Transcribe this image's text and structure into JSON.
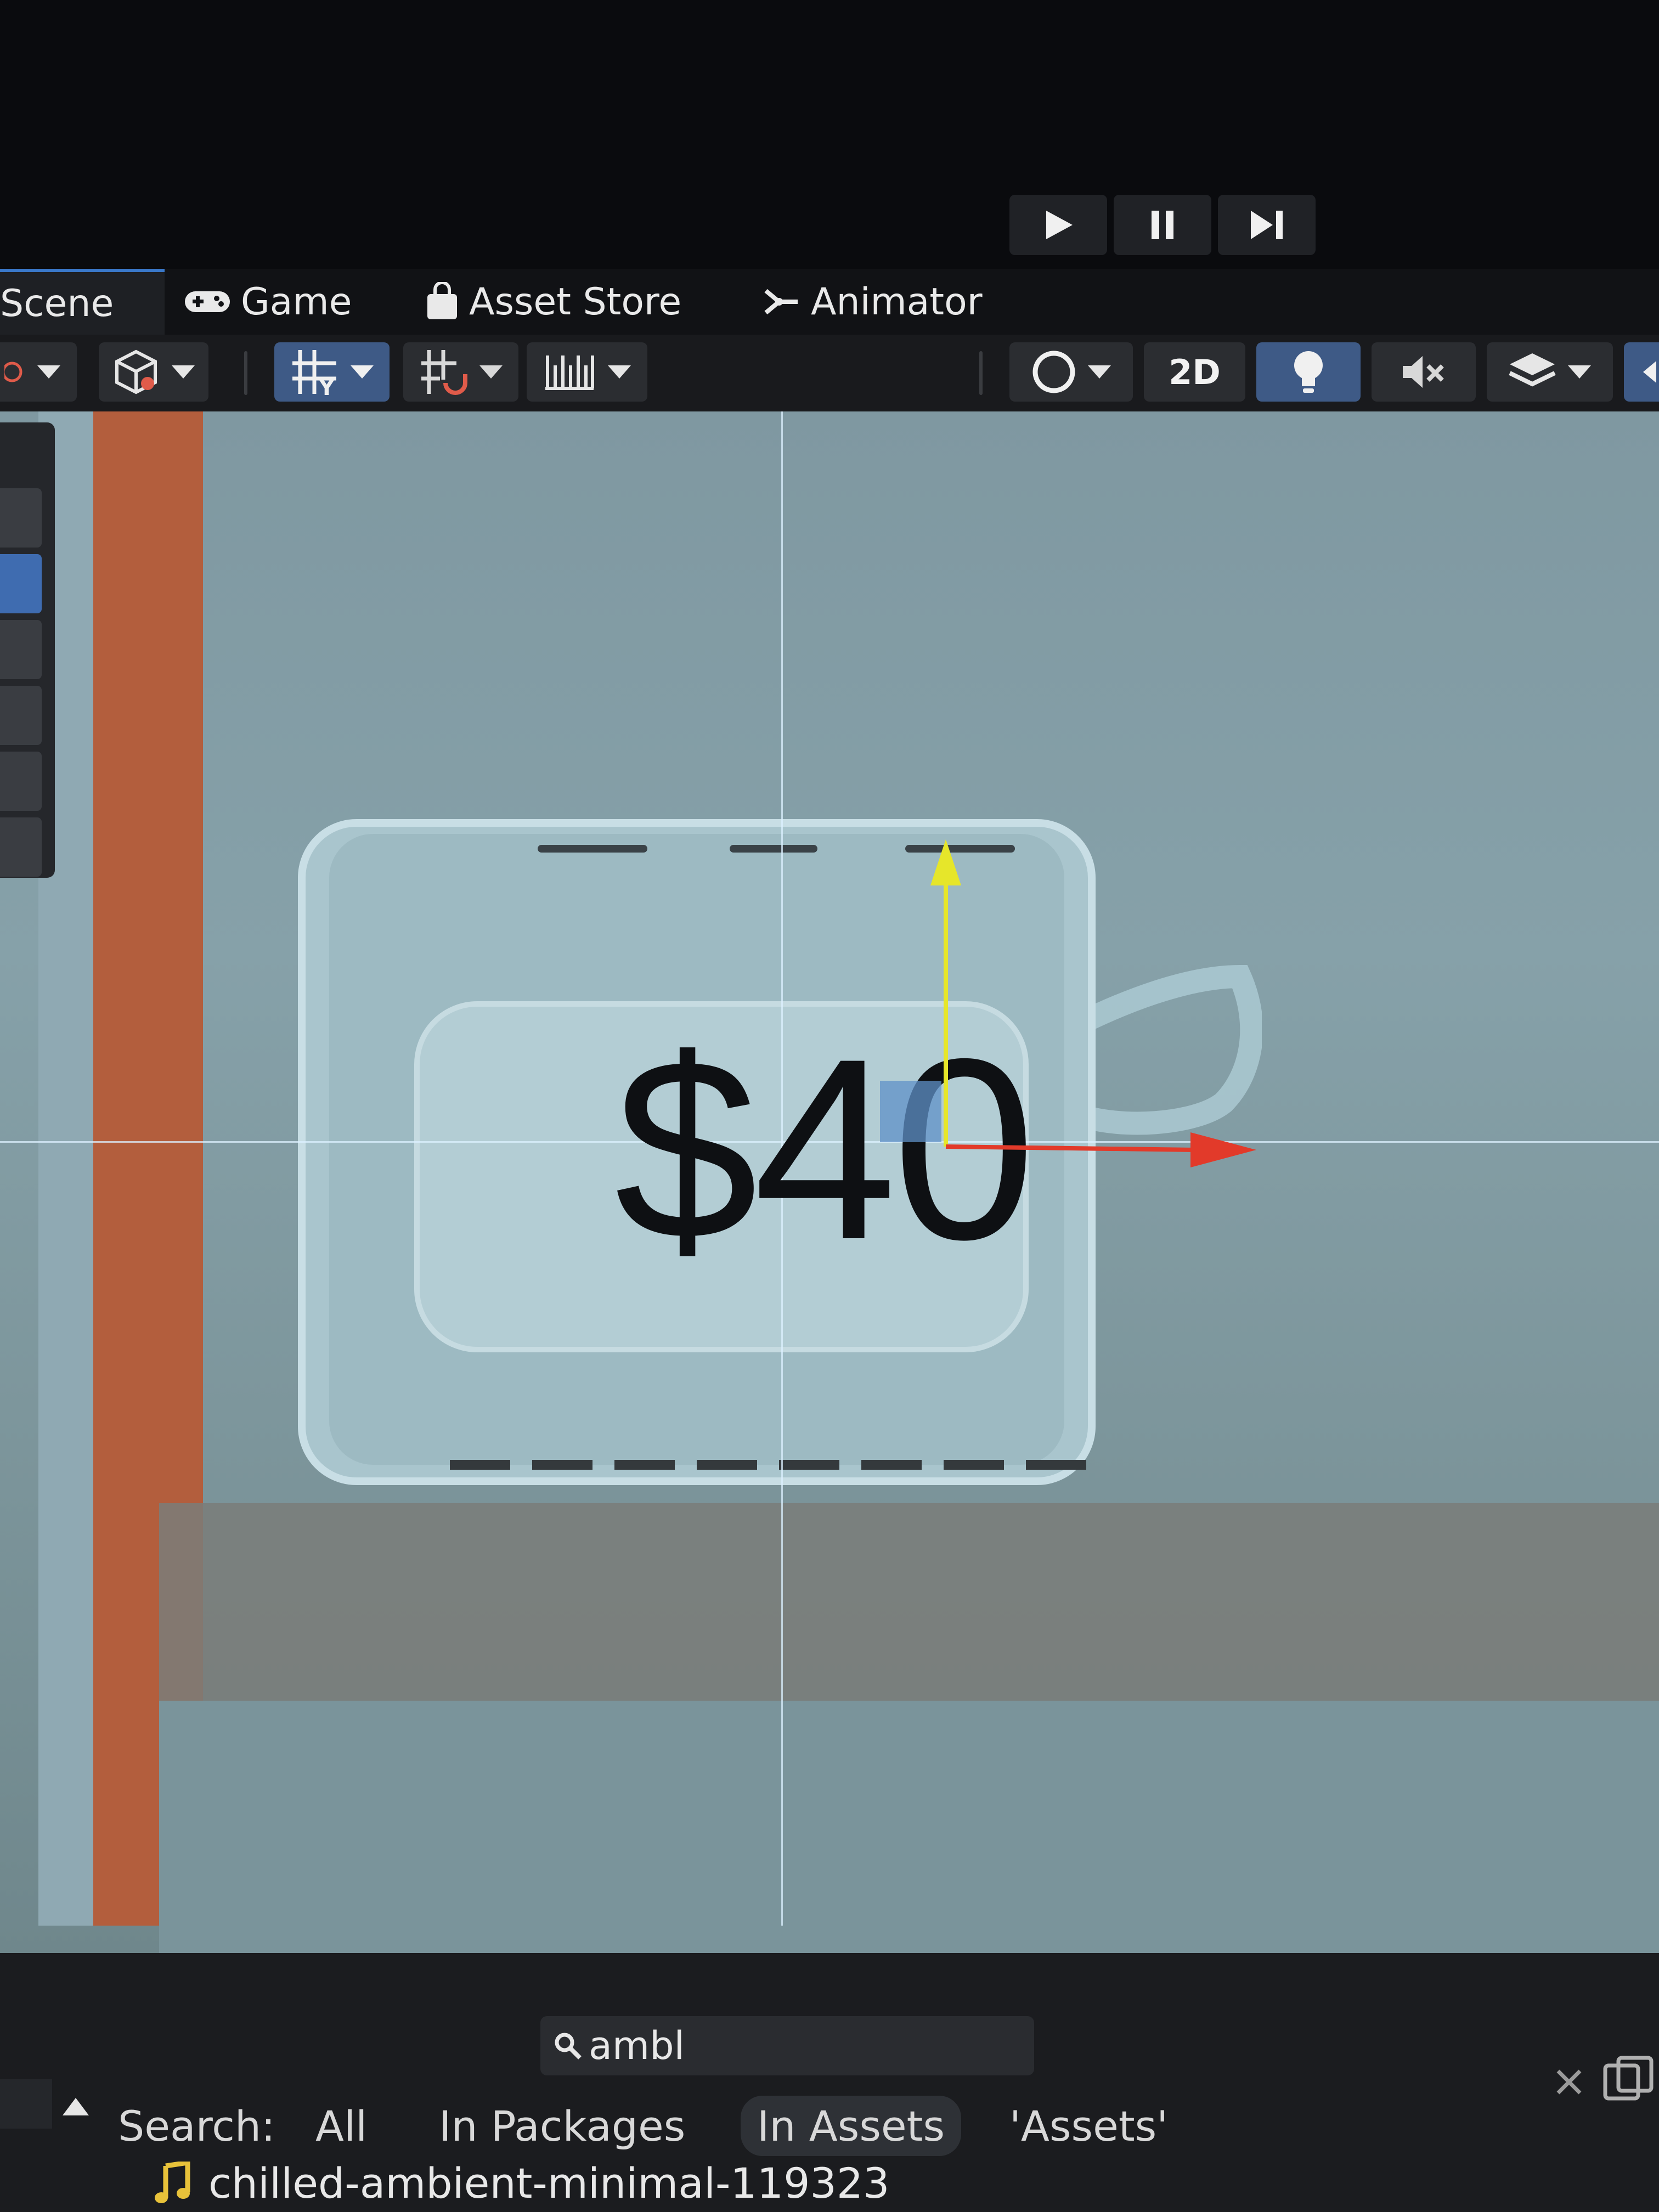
{
  "play_controls": {
    "play": "play-icon",
    "pause": "pause-icon",
    "step": "step-icon"
  },
  "tabs": [
    {
      "label": "Scene",
      "icon": "scene-icon"
    },
    {
      "label": "Game",
      "icon": "gamepad-icon"
    },
    {
      "label": "Asset Store",
      "icon": "shopping-bag-icon"
    },
    {
      "label": "Animator",
      "icon": "animator-icon"
    }
  ],
  "toolbar": {
    "mode_2d_label": "2D"
  },
  "scene": {
    "price_text": "$40",
    "colors": {
      "background": "#86a1a9",
      "orange_strip": "#b35e3d",
      "gizmo_x": "#e23a2a",
      "gizmo_y": "#e6e62a"
    }
  },
  "project": {
    "search_value": "ambl",
    "search_label": "Search:",
    "filters": [
      "All",
      "In Packages",
      "In Assets",
      "'Assets'"
    ],
    "selected_filter": "In Assets",
    "asset_name": "chilled-ambient-minimal-119323"
  }
}
